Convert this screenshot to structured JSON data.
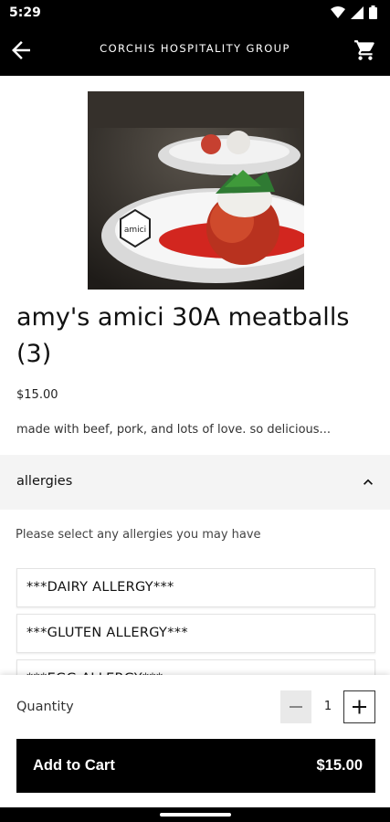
{
  "status_bar": {
    "time": "5:29"
  },
  "app_bar": {
    "title": "CORCHIS HOSPITALITY GROUP"
  },
  "item": {
    "name": "amy's amici 30A meatballs (3)",
    "price": "$15.00",
    "description": "made with beef, pork, and lots of love. so delicious..."
  },
  "allergies_section": {
    "title": "allergies",
    "prompt": "Please select any allergies you may have",
    "options": [
      "***DAIRY ALLERGY***",
      "***GLUTEN ALLERGY***",
      "***EGG ALLERGY***"
    ]
  },
  "quantity": {
    "label": "Quantity",
    "value": "1"
  },
  "add_to_cart": {
    "label": "Add to Cart",
    "total": "$15.00"
  }
}
